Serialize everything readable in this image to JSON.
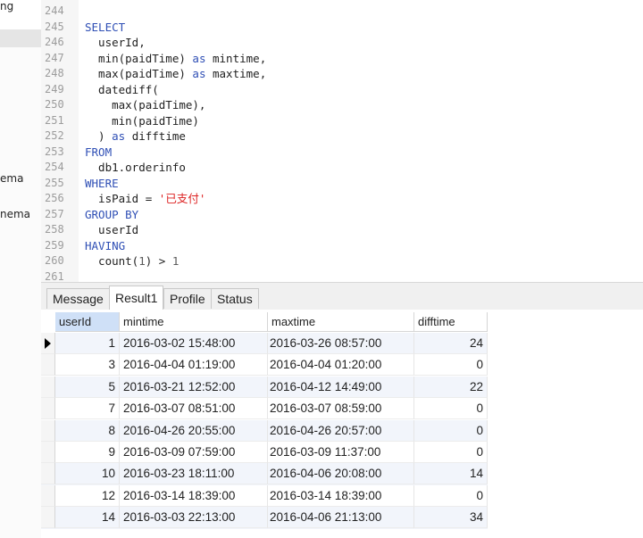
{
  "sidebar": {
    "items": [
      {
        "label": "ng"
      },
      {
        "label": "ema"
      },
      {
        "label": "nema"
      }
    ]
  },
  "editor": {
    "lines": [
      {
        "n": "244",
        "tokens": []
      },
      {
        "n": "245",
        "tokens": [
          {
            "t": "SELECT",
            "c": "kw"
          }
        ]
      },
      {
        "n": "246",
        "tokens": [
          {
            "t": "  userId,",
            "c": ""
          }
        ]
      },
      {
        "n": "247",
        "tokens": [
          {
            "t": "  min(paidTime) ",
            "c": ""
          },
          {
            "t": "as",
            "c": "kw"
          },
          {
            "t": " mintime,",
            "c": ""
          }
        ]
      },
      {
        "n": "248",
        "tokens": [
          {
            "t": "  max(paidTime) ",
            "c": ""
          },
          {
            "t": "as",
            "c": "kw"
          },
          {
            "t": " maxtime,",
            "c": ""
          }
        ]
      },
      {
        "n": "249",
        "tokens": [
          {
            "t": "  datediff(",
            "c": ""
          }
        ]
      },
      {
        "n": "250",
        "tokens": [
          {
            "t": "    max(paidTime),",
            "c": ""
          }
        ]
      },
      {
        "n": "251",
        "tokens": [
          {
            "t": "    min(paidTime)",
            "c": ""
          }
        ]
      },
      {
        "n": "252",
        "tokens": [
          {
            "t": "  ) ",
            "c": ""
          },
          {
            "t": "as",
            "c": "kw"
          },
          {
            "t": " difftime",
            "c": ""
          }
        ]
      },
      {
        "n": "253",
        "tokens": [
          {
            "t": "FROM",
            "c": "kw"
          }
        ]
      },
      {
        "n": "254",
        "tokens": [
          {
            "t": "  db1.orderinfo",
            "c": ""
          }
        ]
      },
      {
        "n": "255",
        "tokens": [
          {
            "t": "WHERE",
            "c": "kw"
          }
        ]
      },
      {
        "n": "256",
        "tokens": [
          {
            "t": "  isPaid = ",
            "c": ""
          },
          {
            "t": "'已支付'",
            "c": "str"
          }
        ]
      },
      {
        "n": "257",
        "tokens": [
          {
            "t": "GROUP BY",
            "c": "kw"
          }
        ]
      },
      {
        "n": "258",
        "tokens": [
          {
            "t": "  userId",
            "c": ""
          }
        ]
      },
      {
        "n": "259",
        "tokens": [
          {
            "t": "HAVING",
            "c": "kw"
          }
        ]
      },
      {
        "n": "260",
        "tokens": [
          {
            "t": "  count(",
            "c": ""
          },
          {
            "t": "1",
            "c": "num"
          },
          {
            "t": ") > ",
            "c": ""
          },
          {
            "t": "1",
            "c": "num"
          }
        ]
      },
      {
        "n": "261",
        "tokens": []
      }
    ]
  },
  "tabs": [
    {
      "label": "Message",
      "active": false
    },
    {
      "label": "Result1",
      "active": true
    },
    {
      "label": "Profile",
      "active": false
    },
    {
      "label": "Status",
      "active": false
    }
  ],
  "grid": {
    "columns": [
      "userId",
      "mintime",
      "maxtime",
      "difftime"
    ],
    "rows": [
      {
        "userId": "1",
        "mintime": "2016-03-02 15:48:00",
        "maxtime": "2016-03-26 08:57:00",
        "difftime": "24"
      },
      {
        "userId": "3",
        "mintime": "2016-04-04 01:19:00",
        "maxtime": "2016-04-04 01:20:00",
        "difftime": "0"
      },
      {
        "userId": "5",
        "mintime": "2016-03-21 12:52:00",
        "maxtime": "2016-04-12 14:49:00",
        "difftime": "22"
      },
      {
        "userId": "7",
        "mintime": "2016-03-07 08:51:00",
        "maxtime": "2016-03-07 08:59:00",
        "difftime": "0"
      },
      {
        "userId": "8",
        "mintime": "2016-04-26 20:55:00",
        "maxtime": "2016-04-26 20:57:00",
        "difftime": "0"
      },
      {
        "userId": "9",
        "mintime": "2016-03-09 07:59:00",
        "maxtime": "2016-03-09 11:37:00",
        "difftime": "0"
      },
      {
        "userId": "10",
        "mintime": "2016-03-23 18:11:00",
        "maxtime": "2016-04-06 20:08:00",
        "difftime": "14"
      },
      {
        "userId": "12",
        "mintime": "2016-03-14 18:39:00",
        "maxtime": "2016-03-14 18:39:00",
        "difftime": "0"
      },
      {
        "userId": "14",
        "mintime": "2016-03-03 22:13:00",
        "maxtime": "2016-04-06 21:13:00",
        "difftime": "34"
      }
    ]
  },
  "colors": {
    "keyword": "#2f4fb5",
    "string": "#dd2222",
    "selected_header": "#cfe0f7"
  }
}
